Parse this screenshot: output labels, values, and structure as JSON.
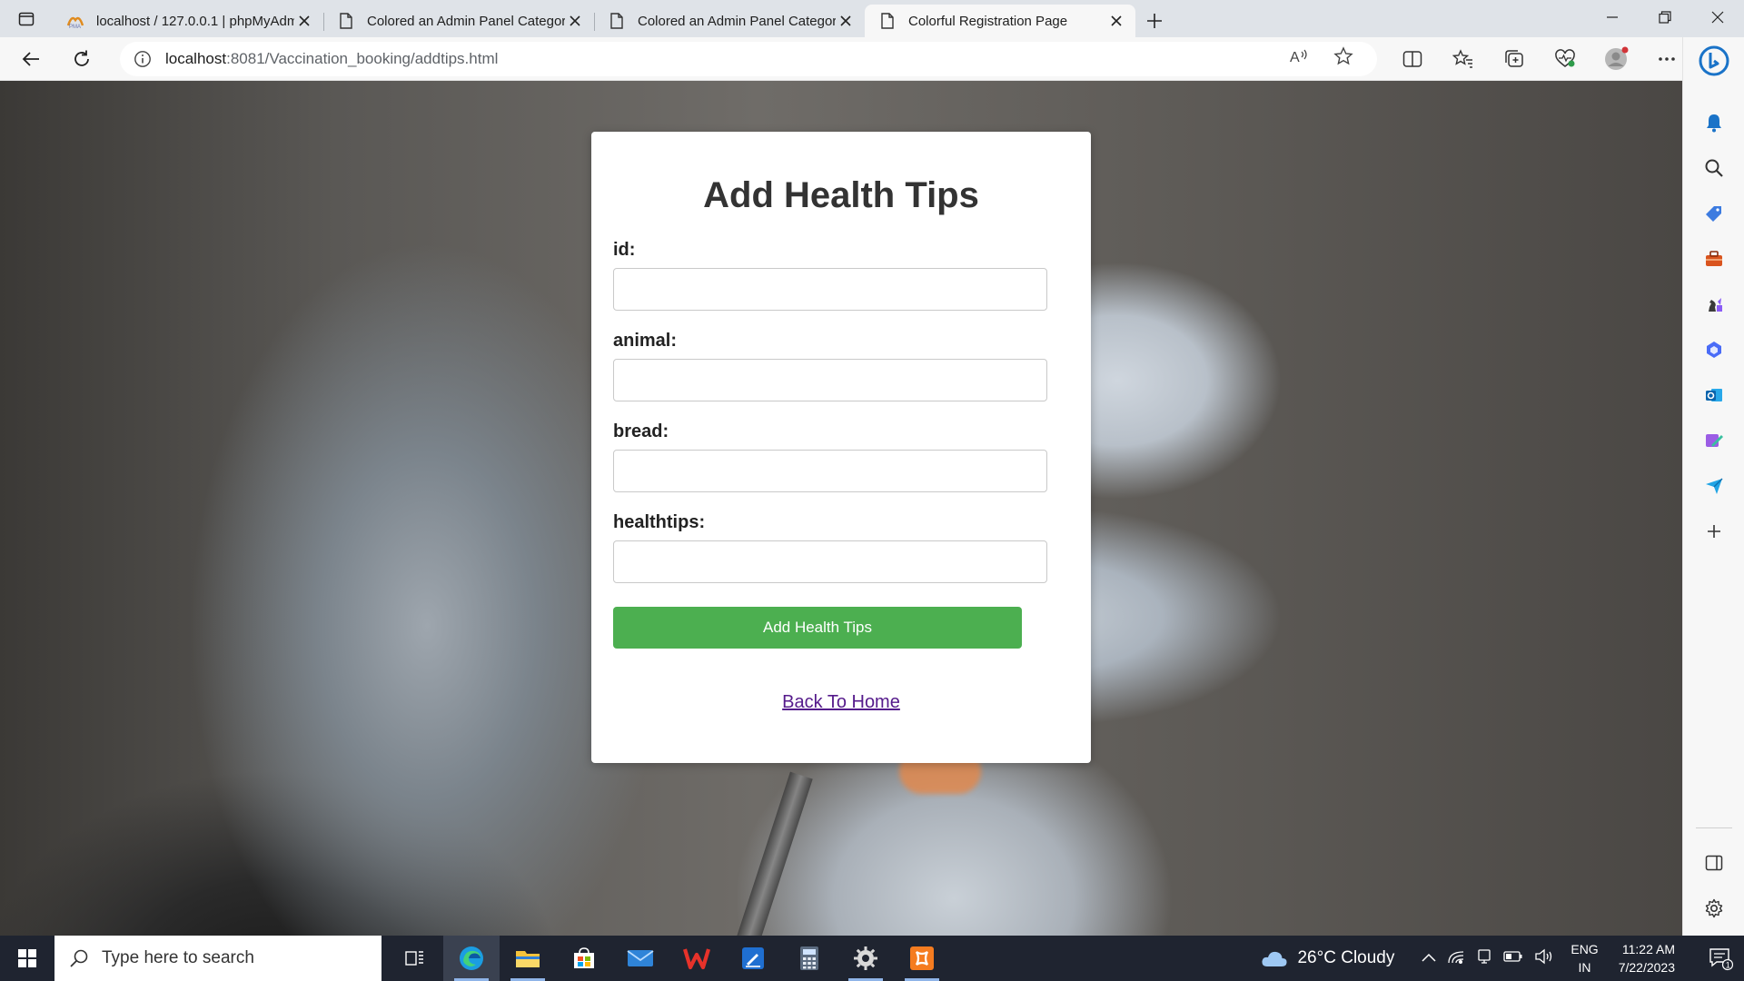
{
  "browser": {
    "tabs": [
      {
        "title": "localhost / 127.0.0.1 | phpMyAdmin",
        "favicon": "phpmyadmin-icon",
        "active": false
      },
      {
        "title": "Colored an Admin Panel Category",
        "favicon": "page-icon",
        "active": false
      },
      {
        "title": "Colored an Admin Panel Category",
        "favicon": "page-icon",
        "active": false
      },
      {
        "title": "Colorful Registration Page",
        "favicon": "page-icon",
        "active": true
      }
    ],
    "url_host": "localhost",
    "url_path": ":8081/Vaccination_booking/addtips.html"
  },
  "form": {
    "title": "Add Health Tips",
    "fields": [
      {
        "label": "id:",
        "value": ""
      },
      {
        "label": "animal:",
        "value": ""
      },
      {
        "label": "bread:",
        "value": ""
      },
      {
        "label": "healthtips:",
        "value": ""
      }
    ],
    "submit_label": "Add Health Tips",
    "back_link": "Back To Home"
  },
  "taskbar": {
    "search_placeholder": "Type here to search",
    "weather": "26°C  Cloudy",
    "lang_line1": "ENG",
    "lang_line2": "IN",
    "time": "11:22 AM",
    "date": "7/22/2023",
    "notification_count": "1"
  },
  "colors": {
    "submit_button": "#4caf50",
    "link": "#551a8b",
    "taskbar": "#1f2430",
    "edge_accent": "#0c59a4"
  }
}
